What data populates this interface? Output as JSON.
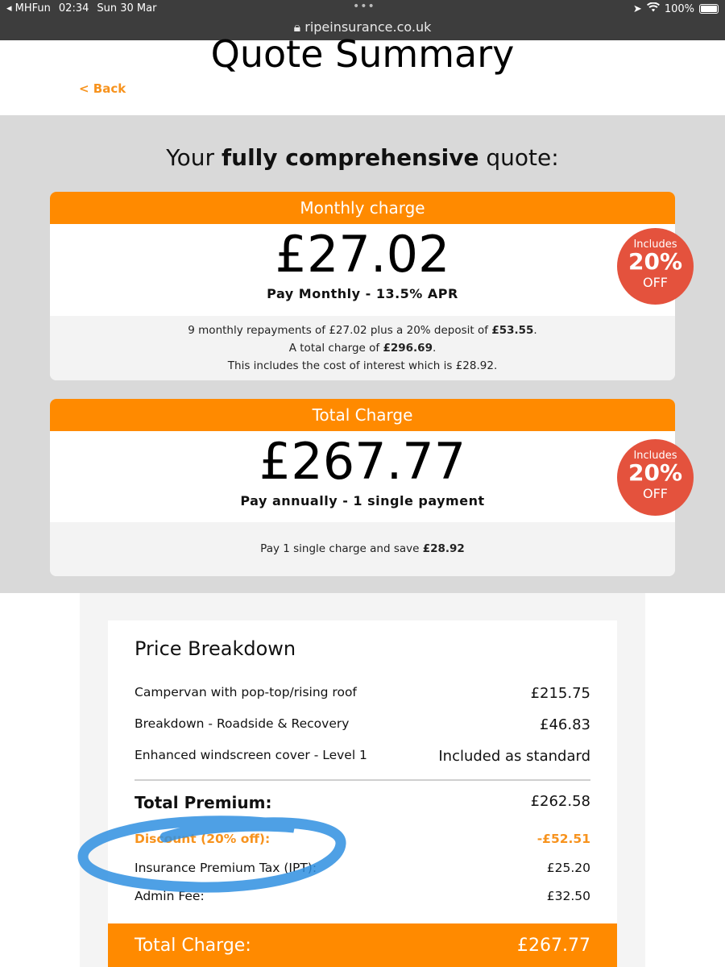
{
  "status_bar": {
    "back_app": "◂ MHFun",
    "time": "02:34",
    "date": "Sun 30 Mar",
    "battery": "100%",
    "url": "ripeinsurance.co.uk"
  },
  "header": {
    "title": "Quote Summary",
    "back_label": "< Back"
  },
  "quote": {
    "heading_pre": "Your ",
    "heading_bold": "fully comprehensive",
    "heading_post": " quote:",
    "monthly": {
      "header": "Monthly charge",
      "price": "£27.02",
      "subtitle": "Pay Monthly - 13.5% APR",
      "line1_pre": "9 monthly repayments of £27.02 plus a 20% deposit of ",
      "line1_bold": "£53.55",
      "line1_post": ".",
      "line2_pre": "A total charge of ",
      "line2_bold": "£296.69",
      "line2_post": ".",
      "line3": "This includes the cost of interest which is £28.92.",
      "badge": {
        "line1": "Includes",
        "line2": "20%",
        "line3": "OFF"
      }
    },
    "total": {
      "header": "Total Charge",
      "price": "£267.77",
      "subtitle": "Pay annually - 1 single payment",
      "footer_pre": "Pay 1 single charge and save ",
      "footer_bold": "£28.92",
      "badge": {
        "line1": "Includes",
        "line2": "20%",
        "line3": "OFF"
      }
    }
  },
  "breakdown": {
    "title": "Price Breakdown",
    "items": [
      {
        "label": "Campervan with pop-top/rising roof",
        "amount": "£215.75"
      },
      {
        "label": "Breakdown - Roadside & Recovery",
        "amount": "£46.83"
      },
      {
        "label": "Enhanced windscreen cover - Level 1",
        "amount": "Included as standard"
      }
    ],
    "total_premium_label": "Total Premium:",
    "total_premium": "£262.58",
    "discount_label": "Discount (20% off):",
    "discount": "-£52.51",
    "ipt_label": "Insurance Premium Tax (IPT):",
    "ipt": "£25.20",
    "admin_label": "Admin Fee:",
    "admin": "£32.50",
    "total_charge_label": "Total Charge:",
    "total_charge": "£267.77"
  },
  "colors": {
    "accent": "#ff8a00",
    "badge": "#e4523d",
    "marker": "#2f8fe0"
  }
}
